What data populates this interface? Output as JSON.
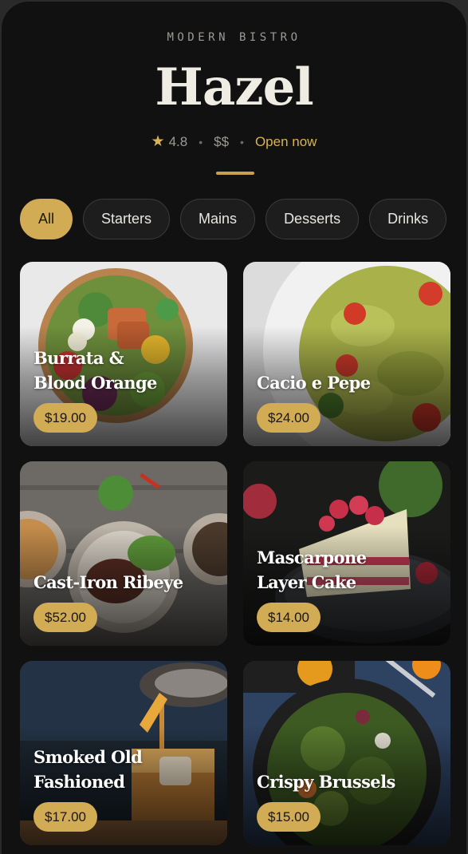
{
  "header": {
    "eyebrow": "MODERN BISTRO",
    "title": "Hazel",
    "rating": "4.8",
    "price_level": "$$",
    "status": "Open now"
  },
  "filters": [
    "All",
    "Starters",
    "Mains",
    "Desserts",
    "Drinks"
  ],
  "active_filter": "All",
  "menu": [
    {
      "name_line1": "Burrata &",
      "name_line2": "Blood Orange",
      "price": "$19.00"
    },
    {
      "name_line1": "",
      "name_line2": "Cacio e Pepe",
      "price": "$24.00"
    },
    {
      "name_line1": "",
      "name_line2": "Cast-Iron Ribeye",
      "price": "$52.00"
    },
    {
      "name_line1": "Mascarpone",
      "name_line2": "Layer Cake",
      "price": "$14.00"
    },
    {
      "name_line1": "Smoked Old",
      "name_line2": "Fashioned",
      "price": "$17.00"
    },
    {
      "name_line1": "",
      "name_line2": "Crispy Brussels",
      "price": "$15.00"
    }
  ],
  "colors": {
    "accent": "#d2ab55",
    "background": "#111111",
    "chip": "#1d1d1d"
  },
  "icons": {
    "rating": "star-icon"
  }
}
